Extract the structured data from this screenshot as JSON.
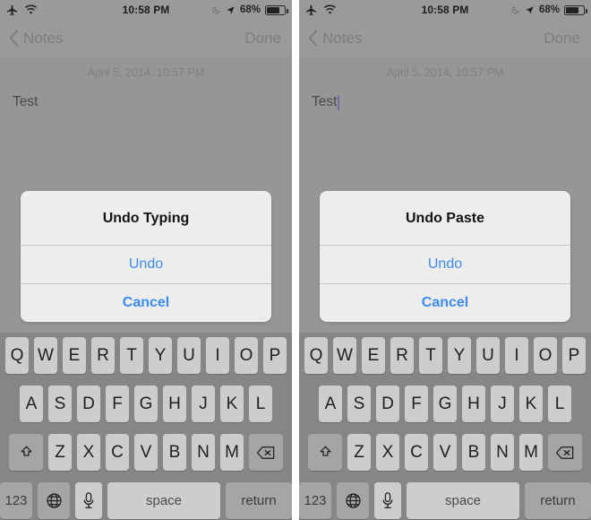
{
  "statusbar": {
    "airplane_icon": "airplane-icon",
    "wifi_icon": "wifi-icon",
    "time": "10:58 PM",
    "dnd_icon": "moon-icon",
    "location_icon": "location-arrow-icon",
    "battery_percent": "68%",
    "battery_icon": "battery-icon"
  },
  "navbar": {
    "back_icon": "chevron-left-icon",
    "back_label": "Notes",
    "done_label": "Done"
  },
  "note": {
    "date": "April 5, 2014, 10:57 PM",
    "text": "Test"
  },
  "panels": [
    {
      "id": "left",
      "alert": {
        "title": "Undo Typing",
        "confirm_label": "Undo",
        "cancel_label": "Cancel"
      },
      "caret_visible": false
    },
    {
      "id": "right",
      "alert": {
        "title": "Undo Paste",
        "confirm_label": "Undo",
        "cancel_label": "Cancel"
      },
      "caret_visible": true
    }
  ],
  "keyboard": {
    "row1": [
      "Q",
      "W",
      "E",
      "R",
      "T",
      "Y",
      "U",
      "I",
      "O",
      "P"
    ],
    "row2": [
      "A",
      "S",
      "D",
      "F",
      "G",
      "H",
      "J",
      "K",
      "L"
    ],
    "row3": [
      "Z",
      "X",
      "C",
      "V",
      "B",
      "N",
      "M"
    ],
    "shift_icon": "shift-arrow-icon",
    "backspace_icon": "backspace-icon",
    "numbers_label": "123",
    "globe_icon": "globe-icon",
    "mic_icon": "microphone-icon",
    "space_label": "space",
    "return_label": "return"
  },
  "colors": {
    "accent_blue": "#3d8bf2",
    "caret_blue": "#6f6fb0",
    "screen_bg": "#969696",
    "keyboard_bg": "#868686"
  }
}
